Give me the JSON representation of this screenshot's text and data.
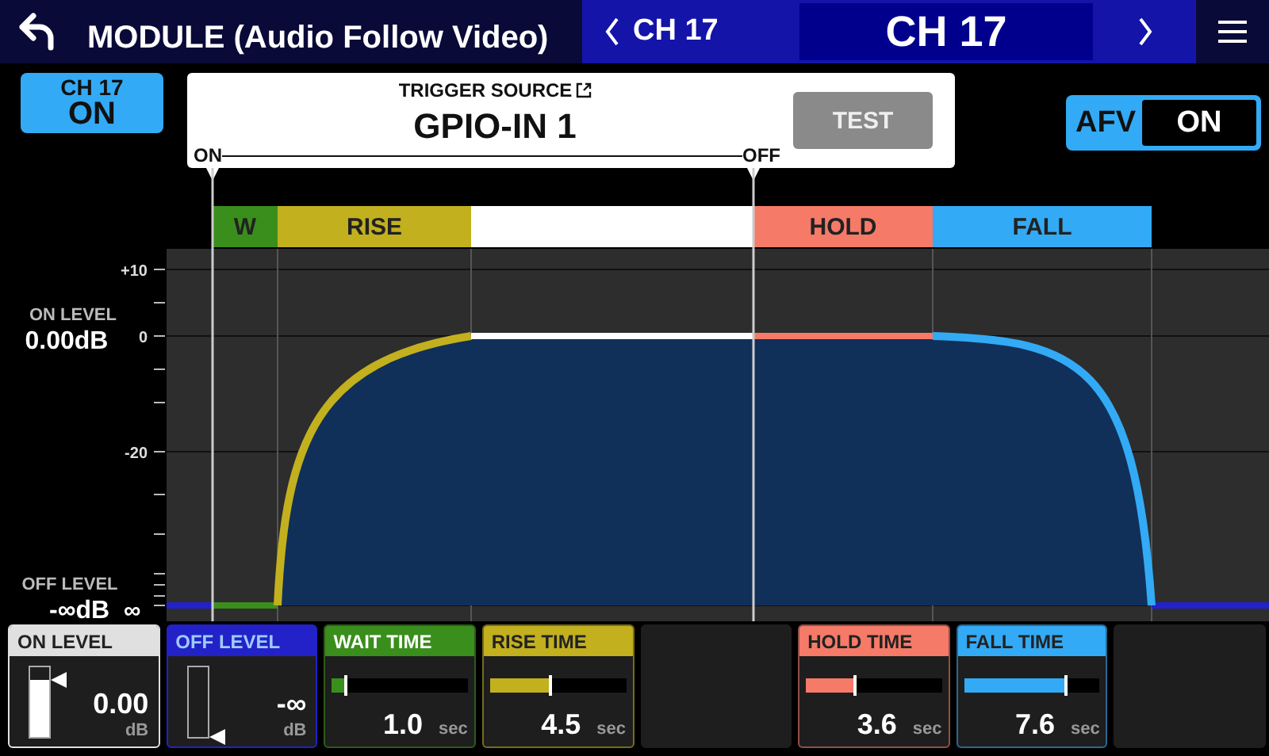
{
  "header": {
    "title": "MODULE (Audio Follow Video)",
    "prev_channel": "CH 17",
    "current_channel": "CH 17"
  },
  "channel_button": {
    "label": "CH 17",
    "state": "ON",
    "on": true
  },
  "trigger": {
    "caption": "TRIGGER SOURCE",
    "source": "GPIO-IN 1",
    "test_label": "TEST",
    "on_label": "ON",
    "off_label": "OFF"
  },
  "afv": {
    "label": "AFV",
    "value": "ON",
    "on": true
  },
  "segments": [
    {
      "label": "W",
      "color": "#3a8e1c"
    },
    {
      "label": "RISE",
      "color": "#c2b01e"
    },
    {
      "color": "#ffffff"
    },
    {
      "label": "HOLD",
      "color": "#f57a68"
    },
    {
      "label": "FALL",
      "color": "#33aaf5"
    }
  ],
  "graph": {
    "scale": [
      "+10",
      "0",
      "-20"
    ],
    "on_level": {
      "caption": "ON LEVEL",
      "value": "0.00dB"
    },
    "off_level": {
      "caption": "OFF LEVEL",
      "value": "-∞dB",
      "suffix": "∞"
    }
  },
  "params": [
    {
      "kind": "level",
      "title": "ON LEVEL",
      "color": "#e0e0e0",
      "level": 0.82,
      "value": "0.00",
      "unit": "dB"
    },
    {
      "kind": "level",
      "title": "OFF LEVEL",
      "color": "#2222c8",
      "level": 0,
      "value": "-∞",
      "unit": "dB"
    },
    {
      "kind": "time",
      "title": "WAIT TIME",
      "color": "#3a8e1c",
      "level": 0.1,
      "value": "1.0",
      "unit": "sec"
    },
    {
      "kind": "time",
      "title": "RISE TIME",
      "color": "#c2b01e",
      "level": 0.45,
      "value": "4.5",
      "unit": "sec"
    },
    {
      "kind": "empty"
    },
    {
      "kind": "time",
      "title": "HOLD TIME",
      "color": "#f57a68",
      "level": 0.36,
      "value": "3.6",
      "unit": "sec"
    },
    {
      "kind": "time",
      "title": "FALL TIME",
      "color": "#33aaf5",
      "level": 0.75,
      "value": "7.6",
      "unit": "sec"
    },
    {
      "kind": "empty"
    }
  ]
}
